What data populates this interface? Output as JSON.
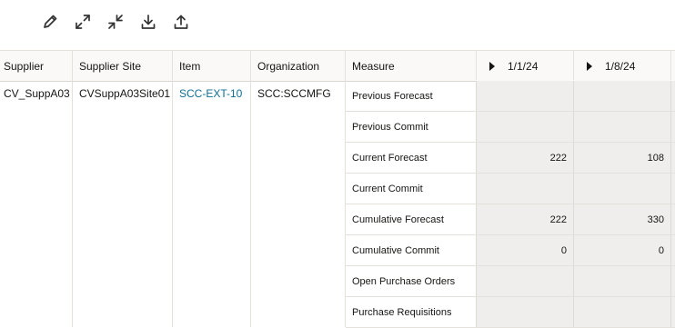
{
  "toolbar": {
    "buttons": [
      {
        "name": "edit-button",
        "icon": "pencil-icon"
      },
      {
        "name": "expand-button",
        "icon": "expand-icon"
      },
      {
        "name": "collapse-button",
        "icon": "collapse-icon"
      },
      {
        "name": "download-button",
        "icon": "download-icon"
      },
      {
        "name": "upload-button",
        "icon": "upload-icon"
      }
    ]
  },
  "table": {
    "headers": {
      "supplier": "Supplier",
      "supplier_site": "Supplier Site",
      "item": "Item",
      "organization": "Organization",
      "measure": "Measure",
      "week1": "1/1/24",
      "week2": "1/8/24"
    },
    "row": {
      "supplier": "CV_SuppA03",
      "supplier_site": "CVSuppA03Site01",
      "item": "SCC-EXT-10",
      "organization": "SCC:SCCMFG"
    },
    "measures": [
      {
        "label": "Previous Forecast",
        "week1": "",
        "week2": ""
      },
      {
        "label": "Previous Commit",
        "week1": "",
        "week2": ""
      },
      {
        "label": "Current Forecast",
        "week1": "222",
        "week2": "108"
      },
      {
        "label": "Current Commit",
        "week1": "",
        "week2": ""
      },
      {
        "label": "Cumulative Forecast",
        "week1": "222",
        "week2": "330"
      },
      {
        "label": "Cumulative Commit",
        "week1": "0",
        "week2": "0"
      },
      {
        "label": "Open Purchase Orders",
        "week1": "",
        "week2": ""
      },
      {
        "label": "Purchase Requisitions",
        "week1": "",
        "week2": ""
      }
    ]
  },
  "colors": {
    "link": "#0e6e94",
    "cell_bg": "#efeeec",
    "header_bg": "#fbf9f8"
  }
}
